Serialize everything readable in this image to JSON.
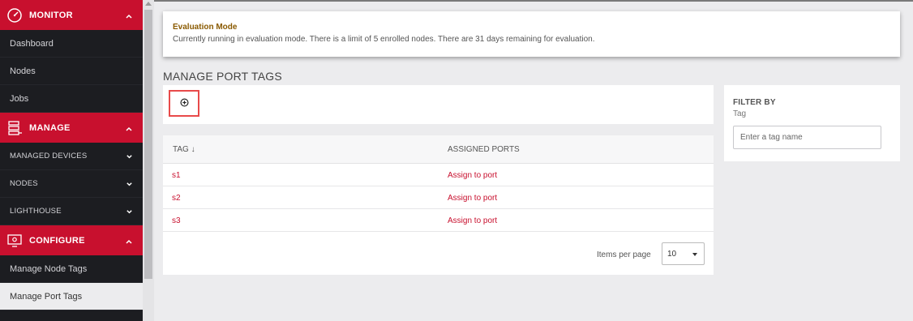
{
  "sidebar": {
    "monitor": {
      "label": "MONITOR",
      "items": [
        "Dashboard",
        "Nodes",
        "Jobs"
      ]
    },
    "manage": {
      "label": "MANAGE",
      "items": [
        "MANAGED DEVICES",
        "NODES",
        "LIGHTHOUSE"
      ]
    },
    "configure": {
      "label": "CONFIGURE",
      "items": [
        "Manage Node Tags",
        "Manage Port Tags"
      ]
    }
  },
  "banner": {
    "title": "Evaluation Mode",
    "text": "Currently running in evaluation mode. There is a limit of 5 enrolled nodes. There are 31 days remaining for evaluation."
  },
  "page": {
    "title": "MANAGE PORT TAGS"
  },
  "table": {
    "columns": [
      "TAG ↓",
      "ASSIGNED PORTS"
    ],
    "rows": [
      {
        "tag": "s1",
        "action": "Assign to port"
      },
      {
        "tag": "s2",
        "action": "Assign to port"
      },
      {
        "tag": "s3",
        "action": "Assign to port"
      }
    ],
    "pager": {
      "label": "Items per page",
      "value": "10"
    }
  },
  "filter": {
    "title": "FILTER BY",
    "label": "Tag",
    "placeholder": "Enter a tag name"
  },
  "colors": {
    "accent": "#c8102e",
    "sidebar_bg": "#1c1d21",
    "banner_title": "#8a5a00",
    "highlight_box": "#e84a4a"
  }
}
